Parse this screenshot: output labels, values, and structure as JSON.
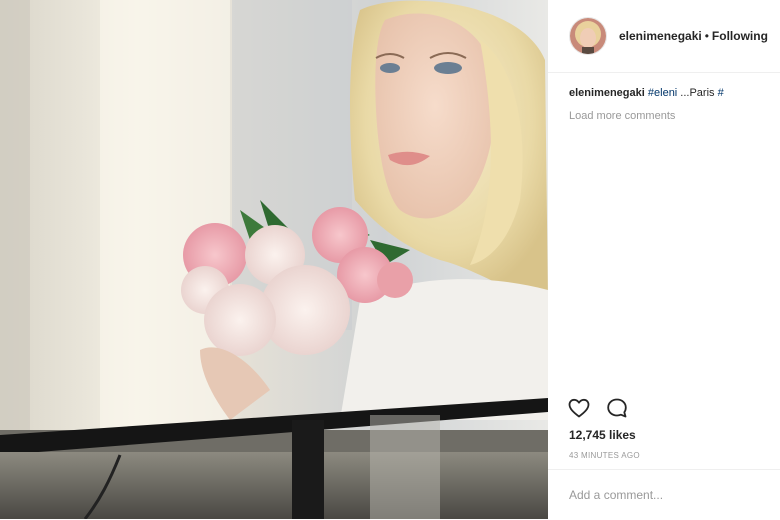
{
  "post": {
    "header": {
      "username": "elenimenegaki",
      "separator": "•",
      "follow_status": "Following"
    },
    "caption": {
      "username": "elenimenegaki",
      "hashtag": "#eleni",
      "text": " ...Paris ",
      "hashtag2": "#"
    },
    "load_more": "Load more comments",
    "likes": "12,745 likes",
    "timestamp": "43 MINUTES AGO",
    "comment_placeholder": "Add a comment..."
  },
  "colors": {
    "link": "#003569",
    "secondary_text": "#999999",
    "primary_text": "#262626",
    "divider": "#efefef"
  },
  "icons": [
    "heart-icon",
    "comment-icon"
  ]
}
